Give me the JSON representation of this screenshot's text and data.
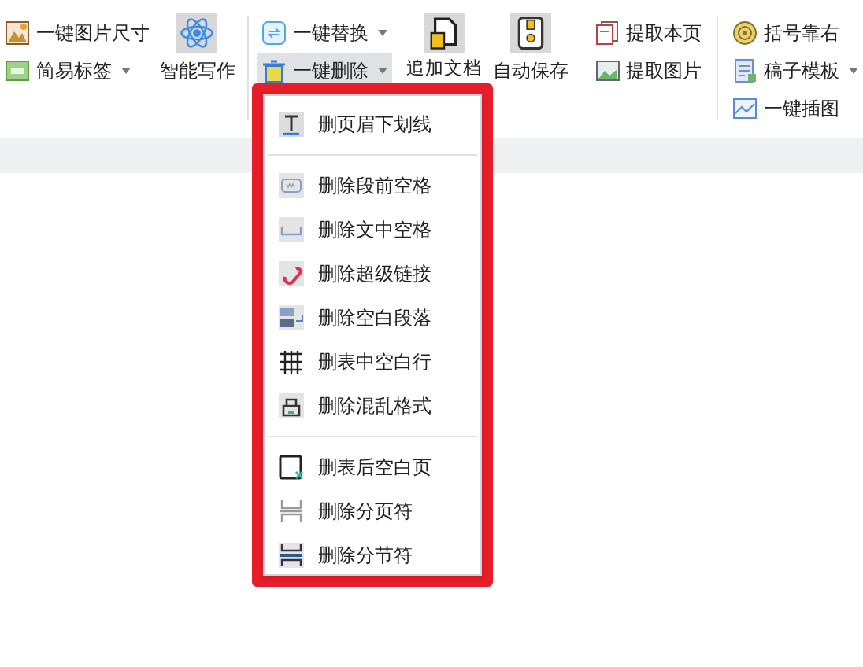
{
  "ribbon": {
    "col1": [
      {
        "label": "一键图片尺寸",
        "dropdown": false
      },
      {
        "label": "简易标签",
        "dropdown": true
      }
    ],
    "col2": {
      "label": "智能写作"
    },
    "col3": [
      {
        "label": "一键替换",
        "dropdown": true,
        "active": false
      },
      {
        "label": "一键删除",
        "dropdown": true,
        "active": true
      }
    ],
    "col4": {
      "label": "追加文档"
    },
    "col5": {
      "label": "自动保存"
    },
    "col6": [
      {
        "label": "提取本页",
        "dropdown": false
      },
      {
        "label": "提取图片",
        "dropdown": false
      }
    ],
    "col7": [
      {
        "label": "括号靠右",
        "dropdown": false
      },
      {
        "label": "稿子模板",
        "dropdown": true
      },
      {
        "label": "一键插图",
        "dropdown": false
      }
    ]
  },
  "menu": {
    "sections": [
      [
        {
          "label": "删页眉下划线"
        }
      ],
      [
        {
          "label": "删除段前空格"
        },
        {
          "label": "删除文中空格"
        },
        {
          "label": "删除超级链接"
        },
        {
          "label": "删除空白段落"
        },
        {
          "label": "删表中空白行"
        },
        {
          "label": "删除混乱格式"
        }
      ],
      [
        {
          "label": "删表后空白页"
        },
        {
          "label": "删除分页符"
        },
        {
          "label": "删除分节符"
        }
      ]
    ]
  }
}
